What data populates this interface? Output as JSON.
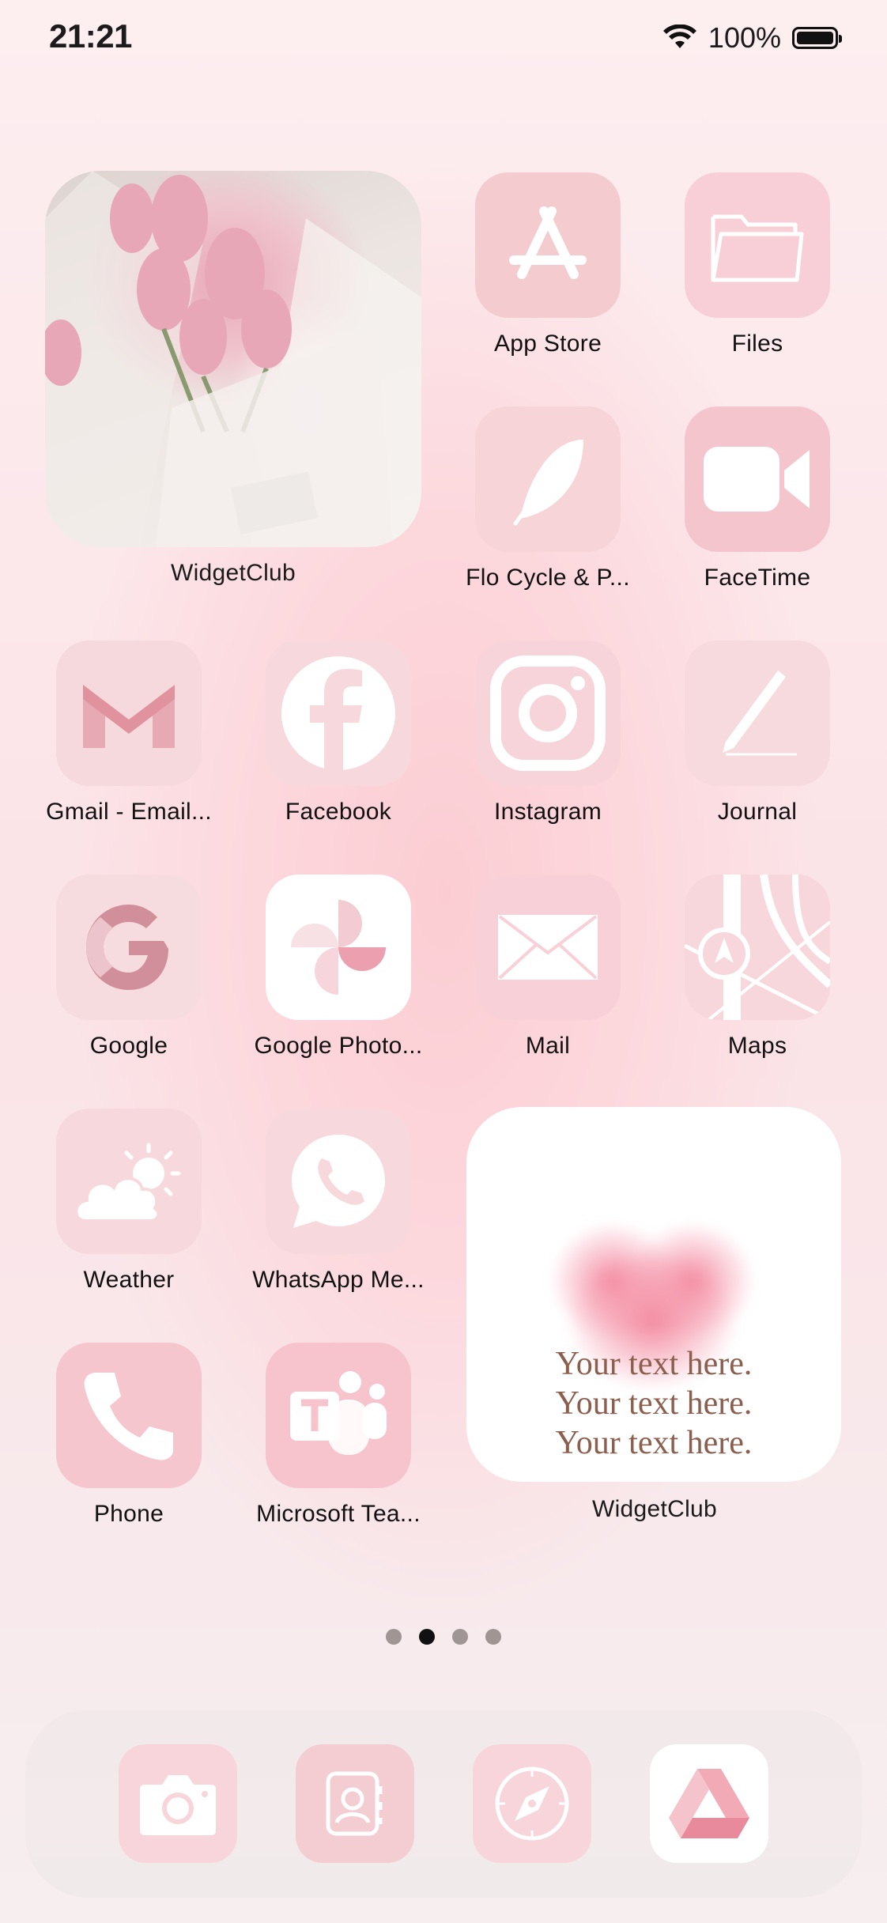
{
  "status_bar": {
    "time": "21:21",
    "battery_percent": "100%",
    "wifi_icon": "wifi-icon",
    "battery_icon": "battery-icon"
  },
  "widgets": {
    "photo": {
      "label": "WidgetClub"
    },
    "text": {
      "label": "WidgetClub",
      "lines": [
        "Your text here.",
        "Your text here.",
        "Your text here."
      ]
    }
  },
  "apps": {
    "app_store": "App Store",
    "files": "Files",
    "flo": "Flo Cycle & P...",
    "facetime": "FaceTime",
    "gmail": "Gmail - Email...",
    "facebook": "Facebook",
    "instagram": "Instagram",
    "journal": "Journal",
    "google": "Google",
    "google_photos": "Google Photo...",
    "mail": "Mail",
    "maps": "Maps",
    "weather": "Weather",
    "whatsapp": "WhatsApp Me...",
    "phone": "Phone",
    "teams": "Microsoft Tea..."
  },
  "page_indicator": {
    "count": 4,
    "active_index": 1
  },
  "dock": [
    "camera-icon",
    "contacts-icon",
    "safari-icon",
    "google-drive-icon"
  ],
  "colors": {
    "accent_pink": "#f4b6c2",
    "icon_pale": "#f6d9dd",
    "text_brown": "#8b5e4e"
  }
}
